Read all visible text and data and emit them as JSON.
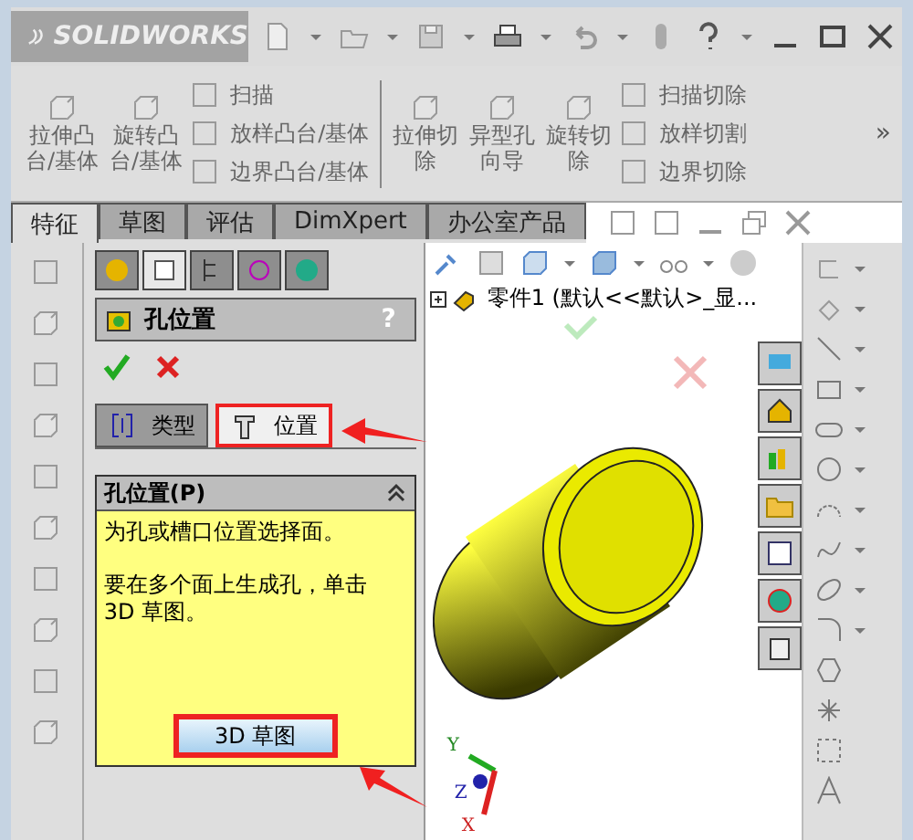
{
  "title_bar": {
    "logo": "SOLIDWORKS"
  },
  "ribbon": {
    "groups": [
      {
        "large": [
          {
            "lines": [
              "拉伸凸",
              "台/基体"
            ]
          },
          {
            "lines": [
              "旋转凸",
              "台/基体"
            ]
          }
        ],
        "small": [
          "扫描",
          "放样凸台/基体",
          "边界凸台/基体"
        ]
      },
      {
        "large": [
          {
            "lines": [
              "拉伸切",
              "除"
            ]
          },
          {
            "lines": [
              "异型孔",
              "向导"
            ]
          },
          {
            "lines": [
              "旋转切",
              "除"
            ]
          }
        ],
        "small": [
          "扫描切除",
          "放样切割",
          "边界切除"
        ]
      }
    ],
    "overflow": "»"
  },
  "tabs": [
    {
      "label": "特征",
      "selected": true
    },
    {
      "label": "草图",
      "selected": false
    },
    {
      "label": "评估",
      "selected": false
    },
    {
      "label": "DimXpert",
      "selected": false
    },
    {
      "label": "办公室产品",
      "selected": false
    }
  ],
  "property_manager": {
    "icon_tabs": [
      {
        "selected": false
      },
      {
        "selected": true
      },
      {
        "selected": false
      },
      {
        "selected": false
      },
      {
        "selected": false
      }
    ],
    "title": "孔位置",
    "help": "?",
    "subtabs": [
      {
        "label": "类型",
        "selected": false,
        "highlighted": false
      },
      {
        "label": "位置",
        "selected": true,
        "highlighted": true
      }
    ],
    "group": {
      "header": "孔位置(P)",
      "messages": [
        "为孔或槽口位置选择面。",
        "要在多个面上生成孔，单击 3D 草图。"
      ],
      "button": {
        "label": "3D 草图",
        "highlighted": true
      }
    }
  },
  "viewport": {
    "tree_item": "零件1 (默认<<默认>_显...",
    "axes": [
      "Y",
      "Z",
      "X"
    ]
  }
}
